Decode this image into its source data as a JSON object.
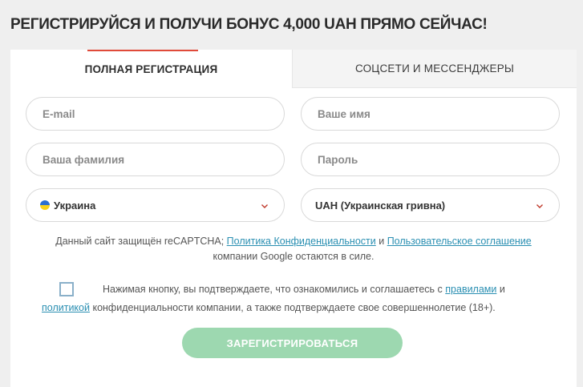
{
  "headline": "РЕГИСТРИРУЙСЯ И ПОЛУЧИ БОНУС 4,000 UAH ПРЯМО СЕЙЧАС!",
  "tabs": {
    "full": "ПОЛНАЯ РЕГИСТРАЦИЯ",
    "social": "СОЦСЕТИ И МЕССЕНДЖЕРЫ"
  },
  "form": {
    "email": {
      "placeholder": "E-mail",
      "value": ""
    },
    "name": {
      "placeholder": "Ваше имя",
      "value": ""
    },
    "surname": {
      "placeholder": "Ваша фамилия",
      "value": ""
    },
    "password": {
      "placeholder": "Пароль",
      "value": ""
    },
    "country": {
      "value": "Украина",
      "icon": "ukraine-flag-icon"
    },
    "currency": {
      "value": "UAH (Украинская гривна)"
    }
  },
  "captcha": {
    "text_before": "Данный сайт защищён reCAPTCHA; ",
    "privacy_link": "Политика Конфиденциальности",
    "and": " и ",
    "terms_link": "Пользовательское соглашение",
    "text_after": "компании Google остаются в силе."
  },
  "consent": {
    "checked": false,
    "text_1": "Нажимая кнопку, вы подтверждаете, что ознакомились и соглашаетесь с ",
    "rules_link": "правилами",
    "text_2": " и ",
    "policy_link": "политикой",
    "text_3": " конфиденциальности компании, а также подтверждаете свое совершеннолетие (18+)."
  },
  "submit_label": "ЗАРЕГИСТРИРОВАТЬСЯ",
  "colors": {
    "accent_red": "#e04a3a",
    "submit_green": "#9dd8b0",
    "link_blue": "#2a8fb2",
    "chevron": "#c0392b"
  }
}
